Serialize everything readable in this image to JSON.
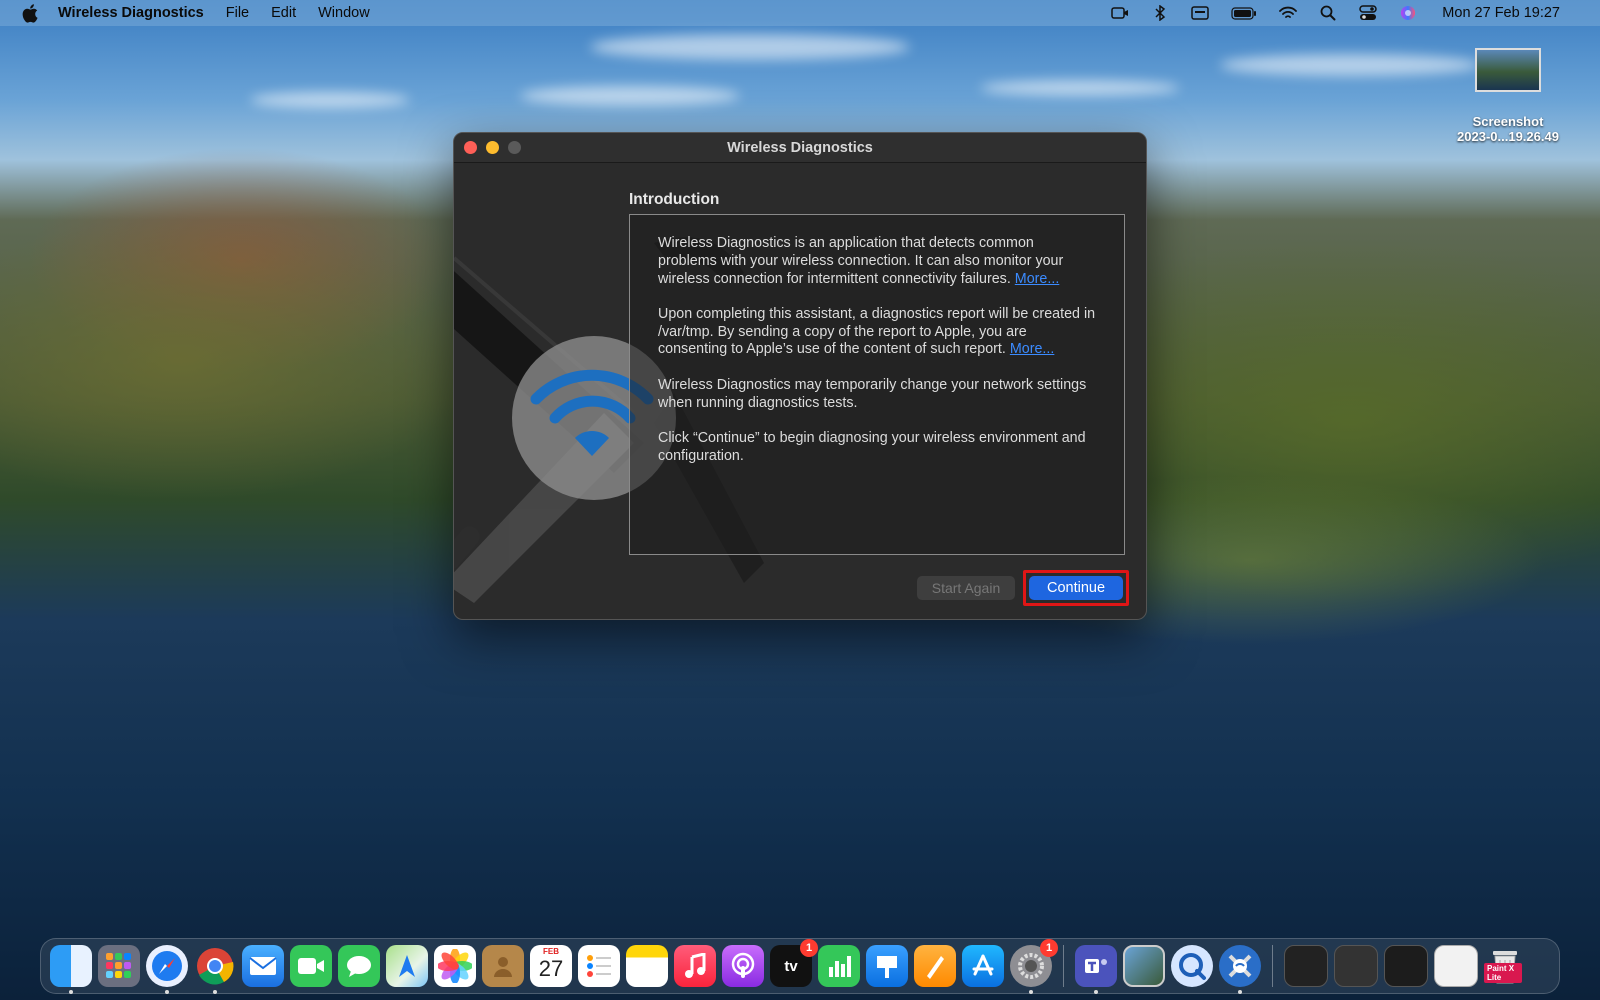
{
  "menubar": {
    "app_name": "Wireless Diagnostics",
    "menus": [
      "File",
      "Edit",
      "Window"
    ],
    "clock": "Mon 27 Feb  19:27"
  },
  "desktop": {
    "file_name_line1": "Screenshot",
    "file_name_line2": "2023-0...19.26.49"
  },
  "window": {
    "title": "Wireless Diagnostics",
    "heading": "Introduction",
    "paragraphs": {
      "p1": "Wireless Diagnostics is an application that detects common problems with your wireless connection. It can also monitor your wireless connection for intermittent connectivity failures.",
      "p1_link": "More...",
      "p2": "Upon completing this assistant, a diagnostics report will be created in /var/tmp. By sending a copy of the report to Apple, you are consenting to Apple’s use of the content of such report.",
      "p2_link": "More...",
      "p3": "Wireless Diagnostics may temporarily change your network settings when running diagnostics tests.",
      "p4": "Click “Continue” to begin diagnosing your wireless environment and configuration."
    },
    "buttons": {
      "start_again": "Start Again",
      "continue": "Continue"
    }
  },
  "dock": {
    "calendar_month": "FEB",
    "calendar_day": "27",
    "appletv_label": "tv",
    "appletv_badge": "1",
    "settings_badge": "1",
    "paint_label": "Paint X Lite"
  },
  "colors": {
    "accent": "#1e66e0",
    "highlight_frame": "#e01616",
    "link": "#3b8bff"
  }
}
